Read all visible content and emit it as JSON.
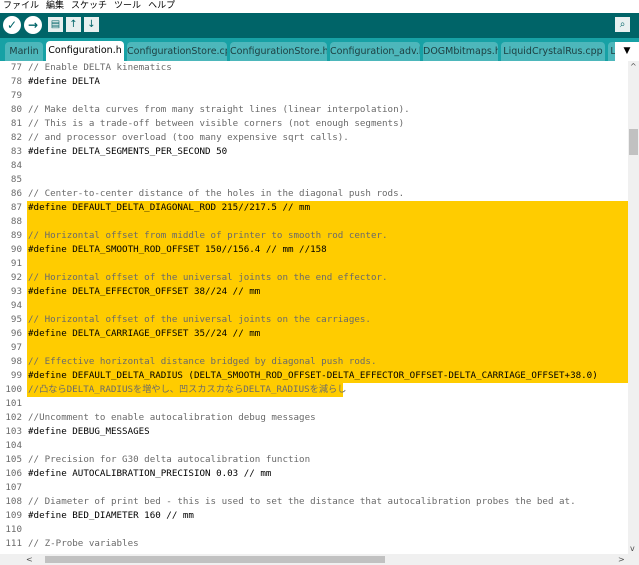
{
  "menu": [
    "ファイル",
    "編集",
    "スケッチ",
    "ツール",
    "ヘルプ"
  ],
  "toolbar": {
    "verify_glyph": "✓",
    "upload_glyph": "→",
    "new_glyph": "▤",
    "open_glyph": "↑",
    "save_glyph": "↓",
    "serial_glyph": "⌕"
  },
  "tabs": [
    {
      "label": "Marlin"
    },
    {
      "label": "Configuration.h"
    },
    {
      "label": "ConfigurationStore.cpp"
    },
    {
      "label": "ConfigurationStore.h"
    },
    {
      "label": "Configuration_adv.h"
    },
    {
      "label": "DOGMbitmaps.h"
    },
    {
      "label": "LiquidCrystalRus.cpp"
    },
    {
      "label": "L"
    }
  ],
  "tab_menu_glyph": "▼",
  "colors": {
    "toolbar": "#006468",
    "tabbar": "#17a1a5",
    "highlight": "#ffcc00"
  },
  "lines": [
    {
      "n": "77",
      "text": "// Enable DELTA kinematics"
    },
    {
      "n": "78",
      "text": "#define DELTA"
    },
    {
      "n": "79",
      "text": ""
    },
    {
      "n": "80",
      "text": "// Make delta curves from many straight lines (linear interpolation)."
    },
    {
      "n": "81",
      "text": "// This is a trade-off between visible corners (not enough segments)"
    },
    {
      "n": "82",
      "text": "// and processor overload (too many expensive sqrt calls)."
    },
    {
      "n": "83",
      "text": "#define DELTA_SEGMENTS_PER_SECOND 50"
    },
    {
      "n": "84",
      "text": ""
    },
    {
      "n": "85",
      "text": ""
    },
    {
      "n": "86",
      "text": "// Center-to-center distance of the holes in the diagonal push rods."
    },
    {
      "n": "87",
      "text": "#define DEFAULT_DELTA_DIAGONAL_ROD 215//217.5 // mm"
    },
    {
      "n": "88",
      "text": ""
    },
    {
      "n": "89",
      "text": "// Horizontal offset from middle of printer to smooth rod center."
    },
    {
      "n": "90",
      "text": "#define DELTA_SMOOTH_ROD_OFFSET 150//156.4 // mm //158"
    },
    {
      "n": "91",
      "text": ""
    },
    {
      "n": "92",
      "text": "// Horizontal offset of the universal joints on the end effector."
    },
    {
      "n": "93",
      "text": "#define DELTA_EFFECTOR_OFFSET 38//24 // mm"
    },
    {
      "n": "94",
      "text": ""
    },
    {
      "n": "95",
      "text": "// Horizontal offset of the universal joints on the carriages."
    },
    {
      "n": "96",
      "text": "#define DELTA_CARRIAGE_OFFSET 35//24 // mm"
    },
    {
      "n": "97",
      "text": ""
    },
    {
      "n": "98",
      "text": "// Effective horizontal distance bridged by diagonal push rods."
    },
    {
      "n": "99",
      "text": "#define DEFAULT_DELTA_RADIUS (DELTA_SMOOTH_ROD_OFFSET-DELTA_EFFECTOR_OFFSET-DELTA_CARRIAGE_OFFSET+38.0)"
    },
    {
      "n": "100",
      "text": "//凸ならDELTA_RADIUSを増やし、凹スカスカならDELTA_RADIUSを減らし"
    },
    {
      "n": "101",
      "text": ""
    },
    {
      "n": "102",
      "text": "//Uncomment to enable autocalibration debug messages"
    },
    {
      "n": "103",
      "text": "#define DEBUG_MESSAGES"
    },
    {
      "n": "104",
      "text": ""
    },
    {
      "n": "105",
      "text": "// Precision for G30 delta autocalibration function"
    },
    {
      "n": "106",
      "text": "#define AUTOCALIBRATION_PRECISION 0.03 // mm"
    },
    {
      "n": "107",
      "text": ""
    },
    {
      "n": "108",
      "text": "// Diameter of print bed - this is used to set the distance that autocalibration probes the bed at."
    },
    {
      "n": "109",
      "text": "#define BED_DIAMETER 160 // mm"
    },
    {
      "n": "110",
      "text": ""
    },
    {
      "n": "111",
      "text": "// Z-Probe variables"
    }
  ],
  "scroll": {
    "left_arrow": "<",
    "right_arrow": ">",
    "up_arrow": "^",
    "down_arrow": "v"
  }
}
